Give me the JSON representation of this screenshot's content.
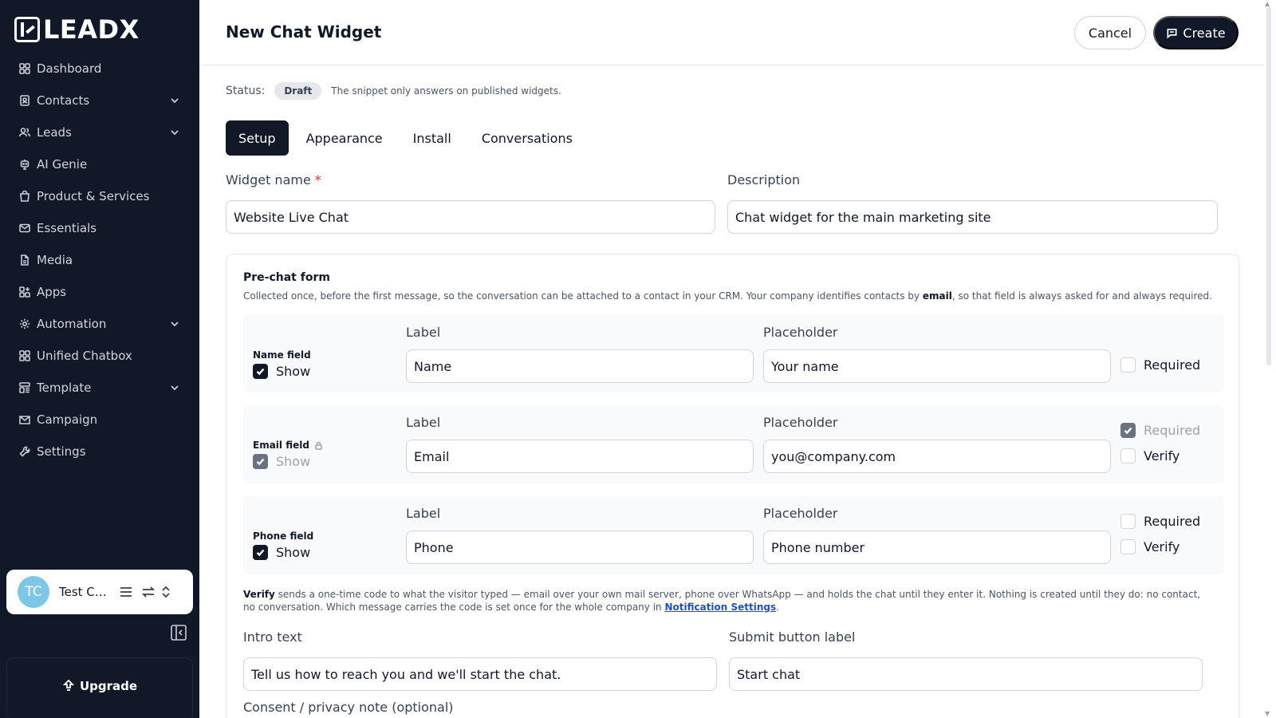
{
  "brand": {
    "name": "LEADX"
  },
  "sidebar": {
    "items": [
      {
        "label": "Dashboard",
        "icon": "dashboard-grid-icon",
        "expandable": false
      },
      {
        "label": "Contacts",
        "icon": "contacts-book-icon",
        "expandable": true
      },
      {
        "label": "Leads",
        "icon": "users-icon",
        "expandable": true
      },
      {
        "label": "AI Genie",
        "icon": "robot-icon",
        "expandable": false
      },
      {
        "label": "Product & Services",
        "icon": "shopping-bag-icon",
        "expandable": false
      },
      {
        "label": "Essentials",
        "icon": "mail-icon",
        "expandable": false
      },
      {
        "label": "Media",
        "icon": "file-icon",
        "expandable": false
      },
      {
        "label": "Apps",
        "icon": "apps-grid-icon",
        "expandable": false
      },
      {
        "label": "Automation",
        "icon": "automation-gear-icon",
        "expandable": true
      },
      {
        "label": "Unified Chatbox",
        "icon": "chatbox-grid-icon",
        "expandable": false
      },
      {
        "label": "Template",
        "icon": "template-icon",
        "expandable": true
      },
      {
        "label": "Campaign",
        "icon": "campaign-mail-icon",
        "expandable": false
      },
      {
        "label": "Settings",
        "icon": "wrench-icon",
        "expandable": false
      }
    ],
    "account": {
      "initials": "TC",
      "name": "Test Co..."
    },
    "upgrade_label": "Upgrade"
  },
  "header": {
    "title": "New Chat Widget",
    "cancel_label": "Cancel",
    "create_label": "Create"
  },
  "status": {
    "label": "Status:",
    "value": "Draft",
    "note": "The snippet only answers on published widgets."
  },
  "tabs": [
    {
      "label": "Setup",
      "active": true
    },
    {
      "label": "Appearance",
      "active": false
    },
    {
      "label": "Install",
      "active": false
    },
    {
      "label": "Conversations",
      "active": false
    }
  ],
  "form": {
    "widget_name_label": "Widget name",
    "widget_name_required_mark": "*",
    "widget_name_value": "Website Live Chat",
    "description_label": "Description",
    "description_value": "Chat widget for the main marketing site"
  },
  "prechat": {
    "title": "Pre-chat form",
    "desc_before": "Collected once, before the first message, so the conversation can be attached to a contact in your CRM. Your company identifies contacts by ",
    "desc_bold": "email",
    "desc_after": ", so that field is always asked for and always required.",
    "label_header": "Label",
    "placeholder_header": "Placeholder",
    "show_label": "Show",
    "required_label": "Required",
    "verify_label": "Verify",
    "fields": [
      {
        "title": "Name field",
        "label_value": "Name",
        "placeholder_value": "Your name",
        "show": true,
        "required": false,
        "locked": false
      },
      {
        "title": "Email field",
        "label_value": "Email",
        "placeholder_value": "you@company.com",
        "show": true,
        "required": true,
        "verify": false,
        "locked": true
      },
      {
        "title": "Phone field",
        "label_value": "Phone",
        "placeholder_value": "Phone number",
        "show": true,
        "required": false,
        "verify": false,
        "locked": false
      }
    ],
    "verify_note_bold": "Verify",
    "verify_note_text": " sends a one-time code to what the visitor typed — email over your own mail server, phone over WhatsApp — and holds the chat until they enter it. Nothing is created until they do: no contact, no conversation. Which message carries the code is set once for the whole company in ",
    "verify_note_link": "Notification Settings",
    "verify_note_end": ".",
    "intro_label": "Intro text",
    "intro_value": "Tell us how to reach you and we'll start the chat.",
    "submit_label": "Submit button label",
    "submit_value": "Start chat",
    "consent_label": "Consent / privacy note (optional)"
  },
  "colors": {
    "sidebar_bg": "#111827",
    "primary": "#111827",
    "required": "#dc2626",
    "link": "#1d4ed8",
    "avatar": "#7cc7e8"
  }
}
